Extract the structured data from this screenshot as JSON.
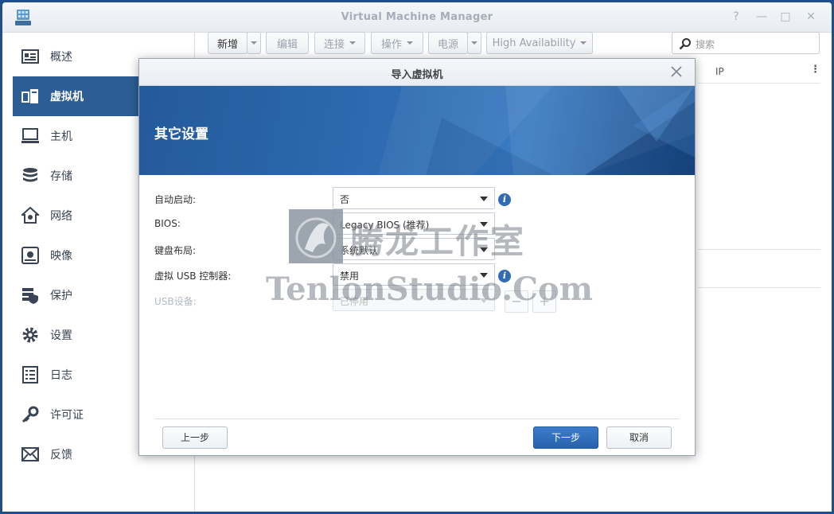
{
  "window": {
    "title": "Virtual Machine Manager",
    "controls": [
      "?",
      "—",
      "□",
      "✕"
    ]
  },
  "sidebar": {
    "items": [
      {
        "label": "概述",
        "icon": "overview-icon"
      },
      {
        "label": "虚拟机",
        "icon": "virtual-machine-icon",
        "active": true
      },
      {
        "label": "主机",
        "icon": "host-icon"
      },
      {
        "label": "存储",
        "icon": "storage-icon"
      },
      {
        "label": "网络",
        "icon": "network-icon"
      },
      {
        "label": "映像",
        "icon": "image-icon"
      },
      {
        "label": "保护",
        "icon": "protection-icon"
      },
      {
        "label": "设置",
        "icon": "settings-icon"
      },
      {
        "label": "日志",
        "icon": "log-icon"
      },
      {
        "label": "许可证",
        "icon": "license-icon"
      },
      {
        "label": "反馈",
        "icon": "feedback-icon"
      }
    ]
  },
  "toolbar": {
    "new_label": "新增",
    "edit_label": "编辑",
    "connect_label": "连接",
    "action_label": "操作",
    "power_label": "电源",
    "ha_label": "High Availability",
    "search_placeholder": "搜索"
  },
  "table": {
    "columns": [
      "IP"
    ]
  },
  "dialog": {
    "title": "导入虚拟机",
    "banner_title": "其它设置",
    "fields": {
      "autostart_label": "自动启动:",
      "autostart_value": "否",
      "bios_label": "BIOS:",
      "bios_value": "Legacy BIOS (推荐)",
      "keyboard_label": "键盘布局:",
      "keyboard_value": "系统默认",
      "usb_controller_label": "虚拟 USB 控制器:",
      "usb_controller_value": "禁用",
      "usb_device_label": "USB设备:",
      "usb_device_value": "已停用"
    },
    "buttons": {
      "back": "上一步",
      "next": "下一步",
      "cancel": "取消"
    }
  },
  "watermark": {
    "cn": "腾龙工作室",
    "en": "TenlonStudio.Com"
  },
  "colors": {
    "accent": "#2c5d95",
    "primary_button": "#2662ad",
    "banner": "#2e6bb1"
  }
}
